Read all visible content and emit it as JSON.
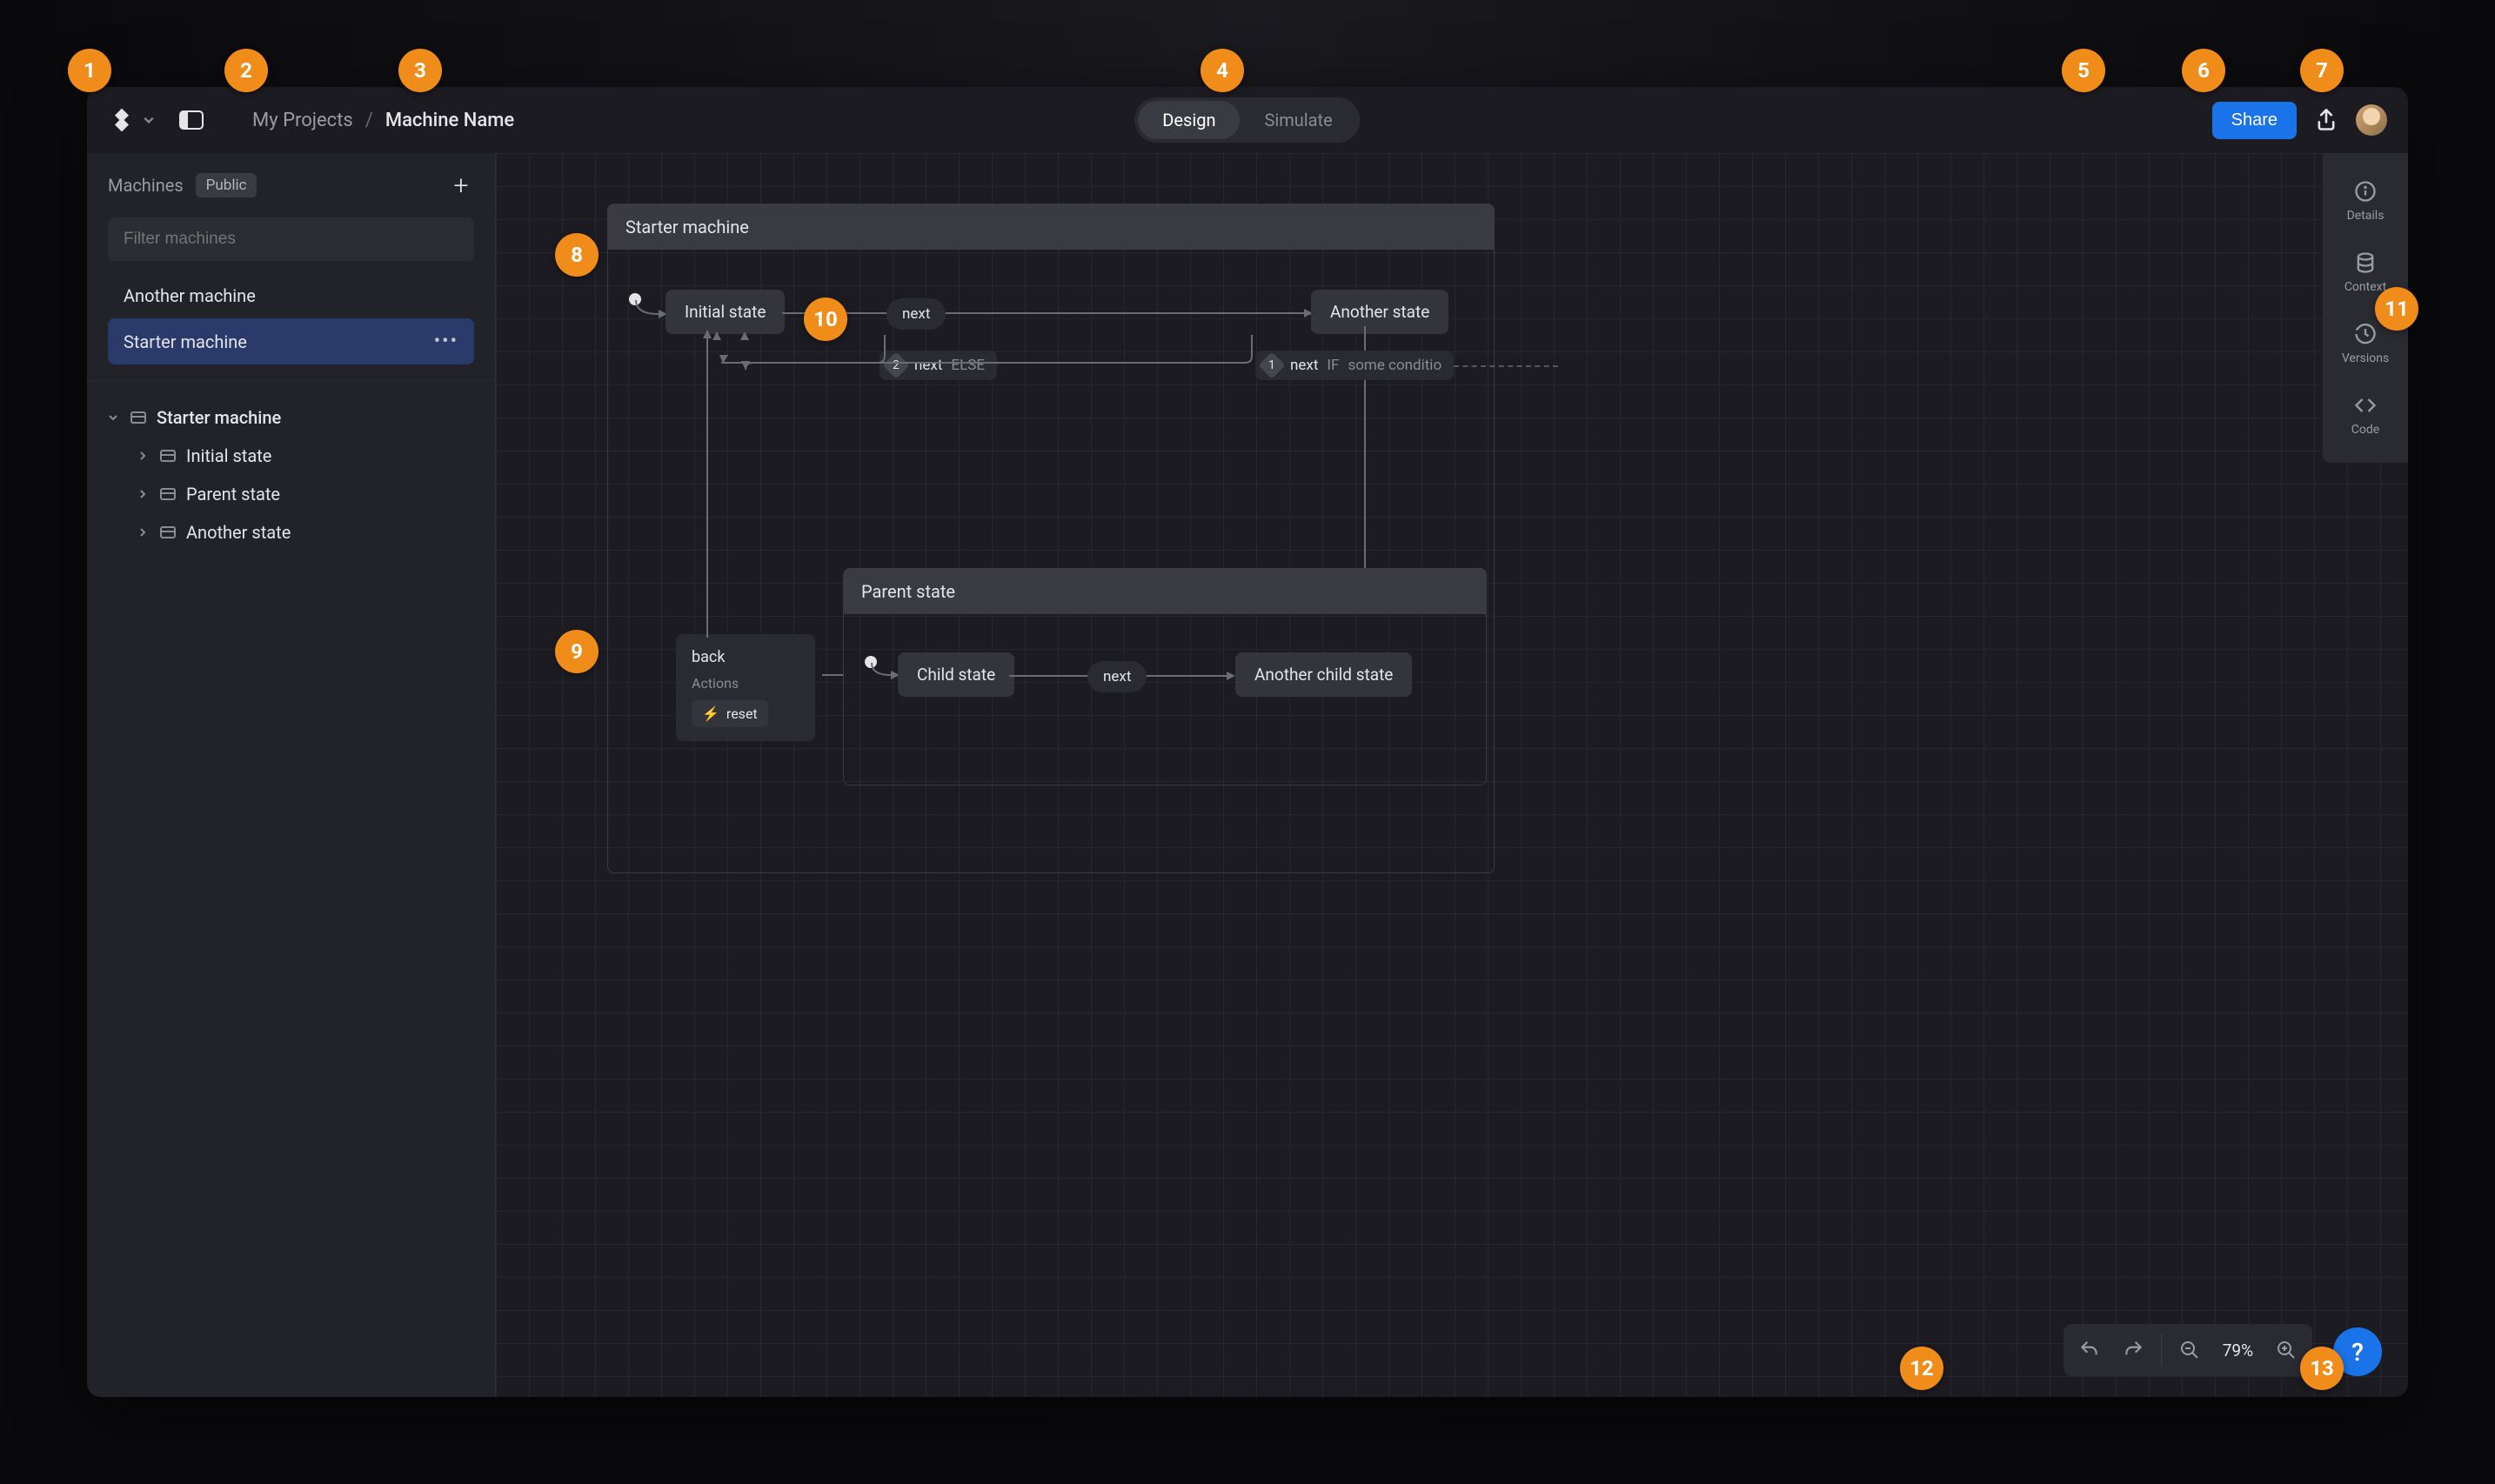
{
  "header": {
    "breadcrumb_parent": "My Projects",
    "breadcrumb_sep": "/",
    "breadcrumb_current": "Machine Name",
    "tab_design": "Design",
    "tab_simulate": "Simulate",
    "share_label": "Share"
  },
  "sidebar": {
    "title": "Machines",
    "badge": "Public",
    "filter_placeholder": "Filter machines",
    "items": [
      {
        "label": "Another machine",
        "selected": false
      },
      {
        "label": "Starter machine",
        "selected": true
      }
    ],
    "tree": {
      "root": "Starter machine",
      "children": [
        {
          "label": "Initial state"
        },
        {
          "label": "Parent state"
        },
        {
          "label": "Another state"
        }
      ]
    }
  },
  "canvas": {
    "machine_title": "Starter machine",
    "states": {
      "initial": "Initial state",
      "another": "Another state",
      "child": "Child state",
      "another_child": "Another child state"
    },
    "parent_title": "Parent state",
    "transitions": {
      "next": "next",
      "back": "back",
      "else": "ELSE",
      "if": "IF",
      "cond": "some conditio",
      "num1": "1",
      "num2": "2"
    },
    "action_box": {
      "title": "back",
      "sub": "Actions",
      "chip": "reset"
    }
  },
  "right_rail": {
    "details": "Details",
    "context": "Context",
    "versions": "Versions",
    "code": "Code"
  },
  "bottom_bar": {
    "zoom": "79%"
  },
  "help": "?",
  "callouts": {
    "1": "1",
    "2": "2",
    "3": "3",
    "4": "4",
    "5": "5",
    "6": "6",
    "7": "7",
    "8": "8",
    "9": "9",
    "10": "10",
    "11": "11",
    "12": "12",
    "13": "13"
  },
  "colors": {
    "accent": "#1a73e8",
    "callout": "#f08c1a",
    "selection": "#2a3a6a"
  }
}
